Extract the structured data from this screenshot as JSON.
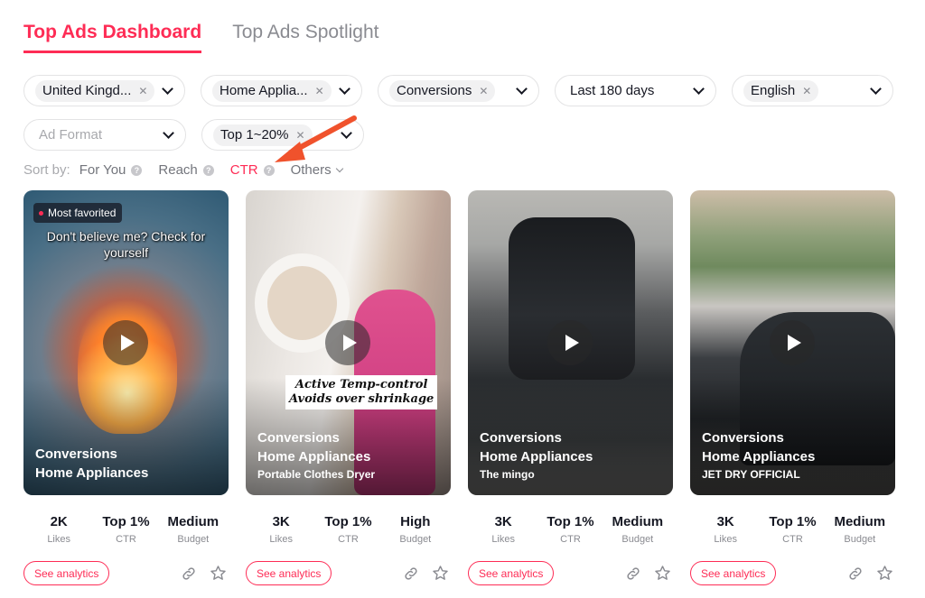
{
  "tabs": {
    "dashboard": "Top Ads Dashboard",
    "spotlight": "Top Ads Spotlight"
  },
  "filters": {
    "region": "United Kingd...",
    "industry": "Home Applia...",
    "objective": "Conversions",
    "period": "Last 180 days",
    "language": "English",
    "ad_format_placeholder": "Ad Format",
    "performance": "Top 1~20%"
  },
  "sort": {
    "label": "Sort by:",
    "for_you": "For You",
    "reach": "Reach",
    "ctr": "CTR",
    "others": "Others"
  },
  "annotation_arrow_color": "#f0522c",
  "accent_color": "#fe2c55",
  "cards": [
    {
      "badge": "Most favorited",
      "caption": "Don't believe me? Check for yourself",
      "objective": "Conversions",
      "industry": "Home Appliances",
      "brand": "",
      "likes": "2K",
      "likes_label": "Likes",
      "ctr": "Top 1%",
      "ctr_label": "CTR",
      "budget": "Medium",
      "budget_label": "Budget",
      "analytics": "See analytics"
    },
    {
      "overlay_text_1": "Active Temp-control",
      "overlay_text_2": "Avoids over shrinkage",
      "objective": "Conversions",
      "industry": "Home Appliances",
      "brand": "Portable Clothes Dryer",
      "likes": "3K",
      "likes_label": "Likes",
      "ctr": "Top 1%",
      "ctr_label": "CTR",
      "budget": "High",
      "budget_label": "Budget",
      "analytics": "See analytics"
    },
    {
      "objective": "Conversions",
      "industry": "Home Appliances",
      "brand": "The mingo",
      "likes": "3K",
      "likes_label": "Likes",
      "ctr": "Top 1%",
      "ctr_label": "CTR",
      "budget": "Medium",
      "budget_label": "Budget",
      "analytics": "See analytics"
    },
    {
      "objective": "Conversions",
      "industry": "Home Appliances",
      "brand": "JET DRY OFFICIAL",
      "likes": "3K",
      "likes_label": "Likes",
      "ctr": "Top 1%",
      "ctr_label": "CTR",
      "budget": "Medium",
      "budget_label": "Budget",
      "analytics": "See analytics"
    }
  ]
}
